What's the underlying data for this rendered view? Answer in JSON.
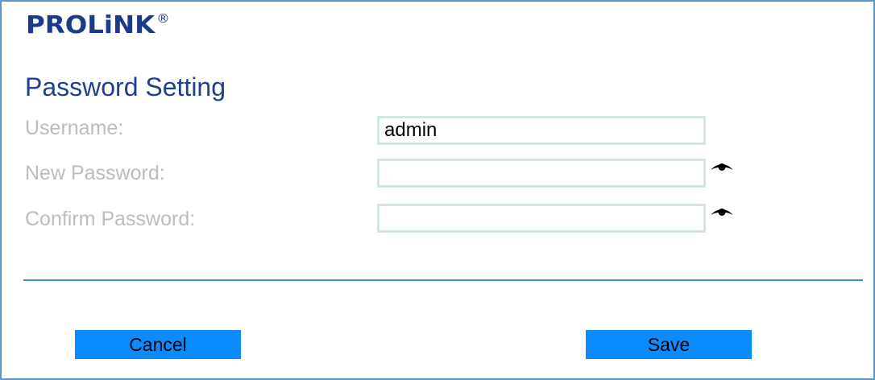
{
  "brand": {
    "logo_text": "PROLiNK",
    "registered_mark": "®"
  },
  "title": "Password Setting",
  "form": {
    "username": {
      "label": "Username:",
      "value": "admin"
    },
    "new_password": {
      "label": "New Password:",
      "value": ""
    },
    "confirm_password": {
      "label": "Confirm Password:",
      "value": ""
    }
  },
  "icons": {
    "reveal": "eye-icon"
  },
  "buttons": {
    "cancel": "Cancel",
    "save": "Save"
  },
  "colors": {
    "accent": "#0a8cff",
    "brand": "#1c3a8a",
    "title": "#1f3f8f",
    "label": "#bdbdbd",
    "field_border": "#d1e6e2",
    "frame_border": "#5b95cf"
  }
}
